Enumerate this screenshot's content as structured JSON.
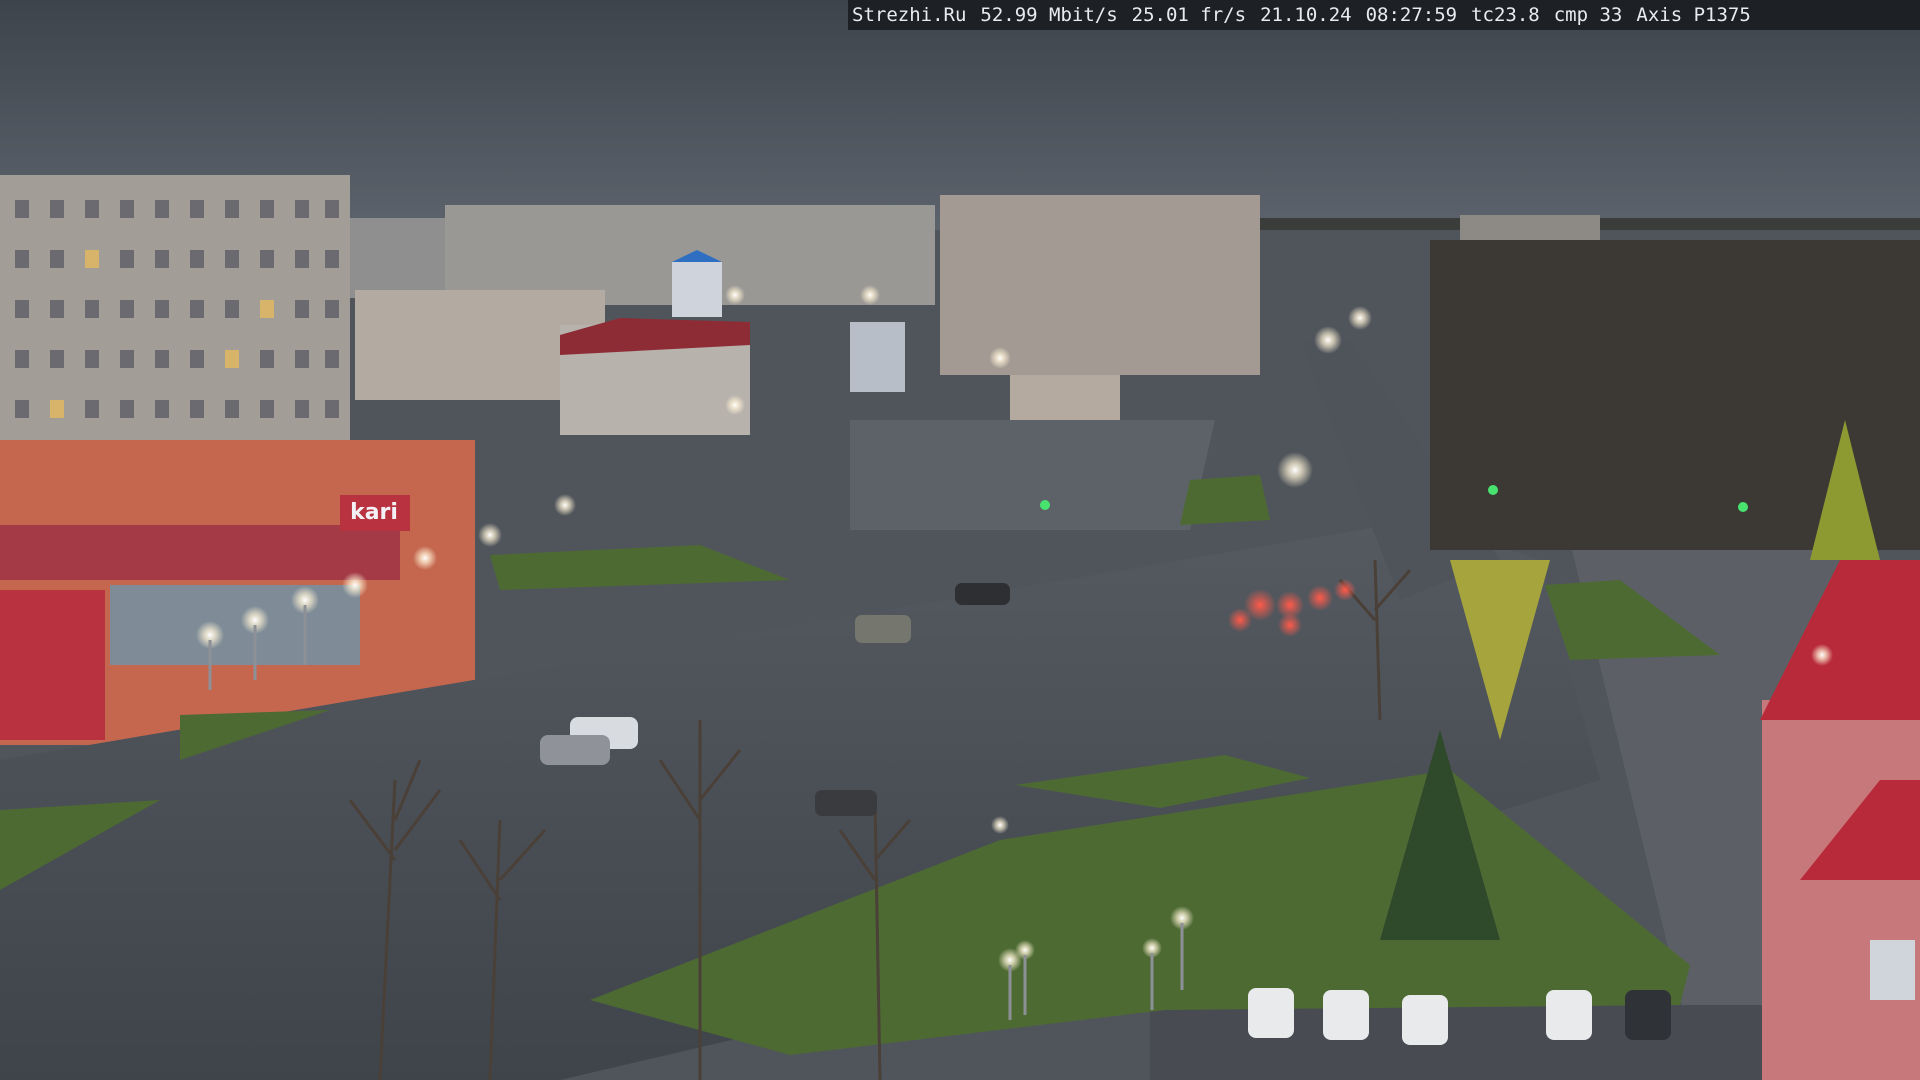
{
  "camera_overlay": {
    "site": "Strezhi.Ru",
    "bitrate": "52.99 Mbit/s",
    "framerate": "25.01 fr/s",
    "date": "21.10.24",
    "time": "08:27:59",
    "tc": "tc23.8",
    "cmp": "cmp 33",
    "model": "Axis P1375"
  },
  "signage": {
    "storefront_brand": "kari"
  },
  "colors": {
    "sky": "#4b525b",
    "asphalt": "#4a4f56",
    "grass": "#4d6a33",
    "storefront_red": "#b8323f",
    "overlay_bg": "#1d2025"
  }
}
